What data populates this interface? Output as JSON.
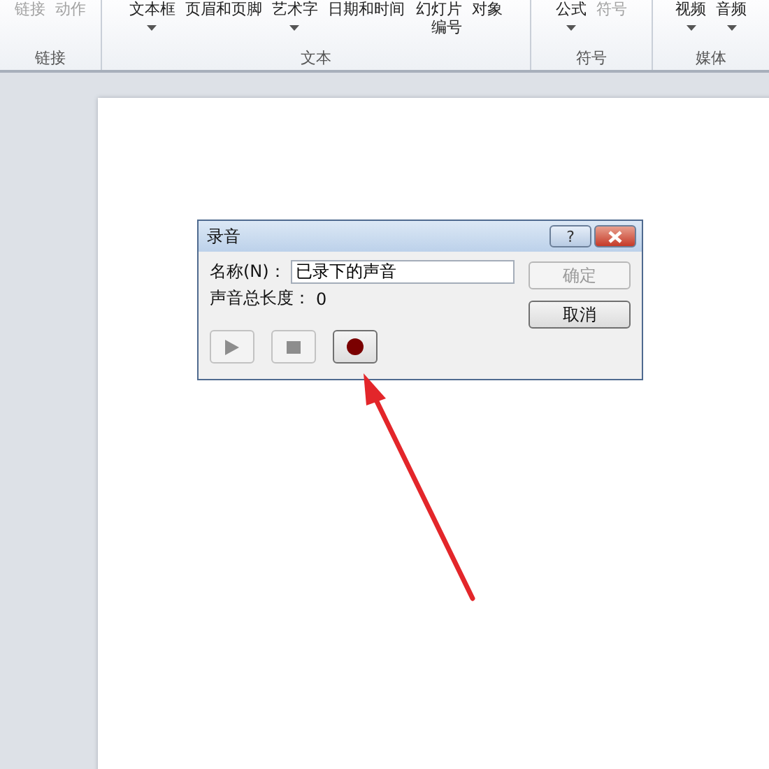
{
  "ribbon": {
    "groups": [
      {
        "label": "链接",
        "items": [
          {
            "label": "链接",
            "disabled": true,
            "dropdown": false,
            "wrapped": false
          },
          {
            "label": "动作",
            "disabled": true,
            "dropdown": false,
            "wrapped": false
          }
        ]
      },
      {
        "label": "文本",
        "items": [
          {
            "label": "文本框",
            "disabled": false,
            "dropdown": true,
            "wrapped": false
          },
          {
            "label": "页眉和页脚",
            "disabled": false,
            "dropdown": false,
            "wrapped": false
          },
          {
            "label": "艺术字",
            "disabled": false,
            "dropdown": true,
            "wrapped": false
          },
          {
            "label": "日期和时间",
            "disabled": false,
            "dropdown": false,
            "wrapped": false
          },
          {
            "label": "幻灯片编号",
            "disabled": false,
            "dropdown": false,
            "wrapped": true
          },
          {
            "label": "对象",
            "disabled": false,
            "dropdown": false,
            "wrapped": false
          }
        ]
      },
      {
        "label": "符号",
        "items": [
          {
            "label": "公式",
            "disabled": false,
            "dropdown": true,
            "wrapped": false
          },
          {
            "label": "符号",
            "disabled": true,
            "dropdown": false,
            "wrapped": false
          }
        ]
      },
      {
        "label": "媒体",
        "items": [
          {
            "label": "视频",
            "disabled": false,
            "dropdown": true,
            "wrapped": false
          },
          {
            "label": "音频",
            "disabled": false,
            "dropdown": true,
            "wrapped": false
          }
        ]
      }
    ]
  },
  "dialog": {
    "title": "录音",
    "help": "?",
    "name_label": "名称(N)：",
    "name_value": "已录下的声音",
    "length_label": "声音总长度：",
    "length_value": "0",
    "buttons": [
      {
        "label": "确定",
        "disabled": true
      },
      {
        "label": "取消",
        "disabled": false
      }
    ],
    "transport": [
      {
        "kind": "play",
        "disabled": true
      },
      {
        "kind": "stop",
        "disabled": true
      },
      {
        "kind": "record",
        "disabled": false
      }
    ]
  }
}
